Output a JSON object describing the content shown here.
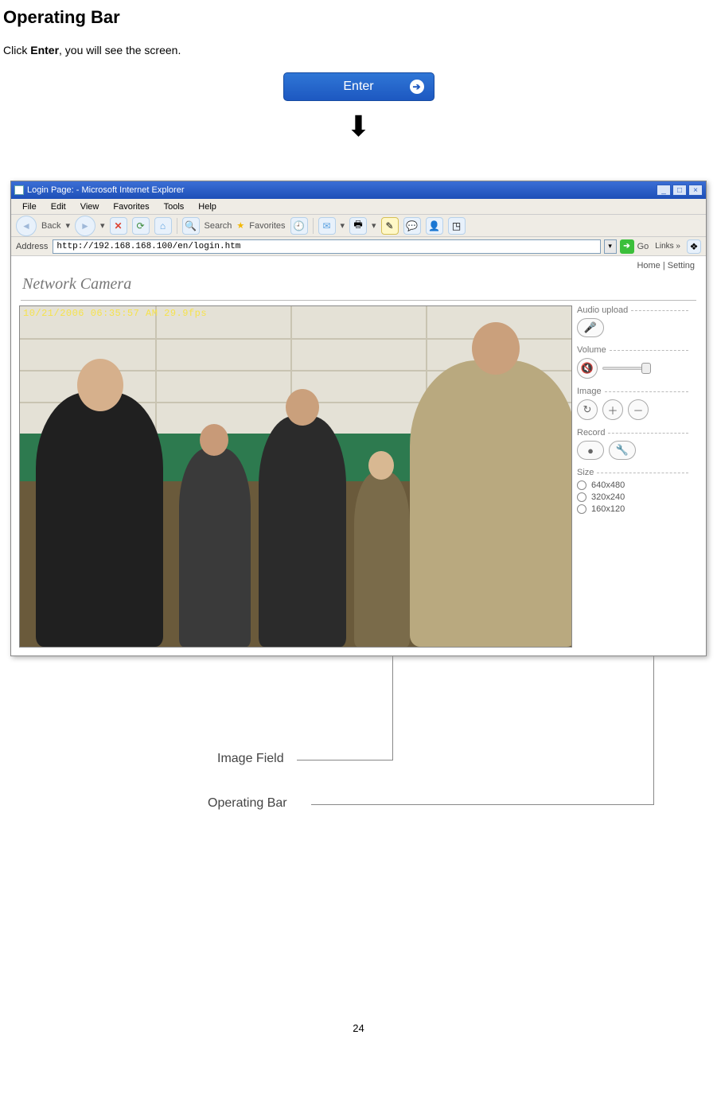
{
  "page": {
    "heading": "Operating Bar",
    "intro_prefix": "Click ",
    "intro_bold": "Enter",
    "intro_suffix": ", you will see the screen.",
    "page_number": "24"
  },
  "enter_button": {
    "label": "Enter"
  },
  "ie": {
    "title": "Login Page: - Microsoft Internet Explorer",
    "menus": [
      "File",
      "Edit",
      "View",
      "Favorites",
      "Tools",
      "Help"
    ],
    "toolbar": {
      "back": "Back",
      "search": "Search",
      "favorites": "Favorites"
    },
    "address_label": "Address",
    "address_value": "http://192.168.168.100/en/login.htm",
    "go_label": "Go",
    "links_label": "Links"
  },
  "camera_page": {
    "top_links": "Home | Setting",
    "title": "Network Camera",
    "osd": "10/21/2006 06:35:57 AM   29.9fps",
    "panel": {
      "audio_upload": "Audio upload",
      "volume": "Volume",
      "image": "Image",
      "record": "Record",
      "size": "Size",
      "sizes": [
        "640x480",
        "320x240",
        "160x120"
      ]
    }
  },
  "annotations": {
    "image_field": "Image Field",
    "operating_bar": "Operating Bar"
  }
}
